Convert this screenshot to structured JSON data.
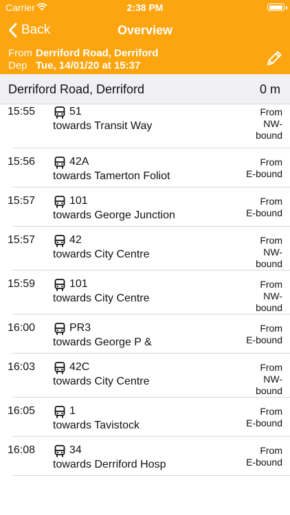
{
  "status_bar": {
    "carrier": "Carrier",
    "time": "2:38 PM",
    "battery_level": 0.95
  },
  "nav": {
    "back_label": "Back",
    "title": "Overview"
  },
  "trip": {
    "from_label": "From",
    "from_value": "Derriford Road, Derriford",
    "dep_label": "Dep",
    "dep_value": "Tue, 14/01/20 at 15:37",
    "edit_icon": "pencil-icon"
  },
  "stop": {
    "name": "Derriford Road, Derriford",
    "distance": "0 m"
  },
  "departures": [
    {
      "time": "15:55",
      "route": "51",
      "towards": "towards Transit Way",
      "direction": [
        "From",
        "NW-",
        "bound"
      ]
    },
    {
      "time": "15:56",
      "route": "42A",
      "towards": "towards Tamerton Foliot",
      "direction": [
        "From",
        "E-bound"
      ]
    },
    {
      "time": "15:57",
      "route": "101",
      "towards": "towards George Junction",
      "direction": [
        "From",
        "E-bound"
      ]
    },
    {
      "time": "15:57",
      "route": "42",
      "towards": "towards City Centre",
      "direction": [
        "From",
        "NW-",
        "bound"
      ]
    },
    {
      "time": "15:59",
      "route": "101",
      "towards": "towards City Centre",
      "direction": [
        "From",
        "NW-",
        "bound"
      ]
    },
    {
      "time": "16:00",
      "route": "PR3",
      "towards": "towards George P &",
      "direction": [
        "From",
        "E-bound"
      ]
    },
    {
      "time": "16:03",
      "route": "42C",
      "towards": "towards City Centre",
      "direction": [
        "From",
        "NW-",
        "bound"
      ]
    },
    {
      "time": "16:05",
      "route": "1",
      "towards": "towards Tavistock",
      "direction": [
        "From",
        "E-bound"
      ]
    },
    {
      "time": "16:08",
      "route": "34",
      "towards": "towards Derriford Hosp",
      "direction": [
        "From",
        "E-bound"
      ]
    }
  ],
  "colors": {
    "accent": "#fca50f",
    "header_bg": "#efeff4",
    "separator": "#d8d8dc"
  }
}
